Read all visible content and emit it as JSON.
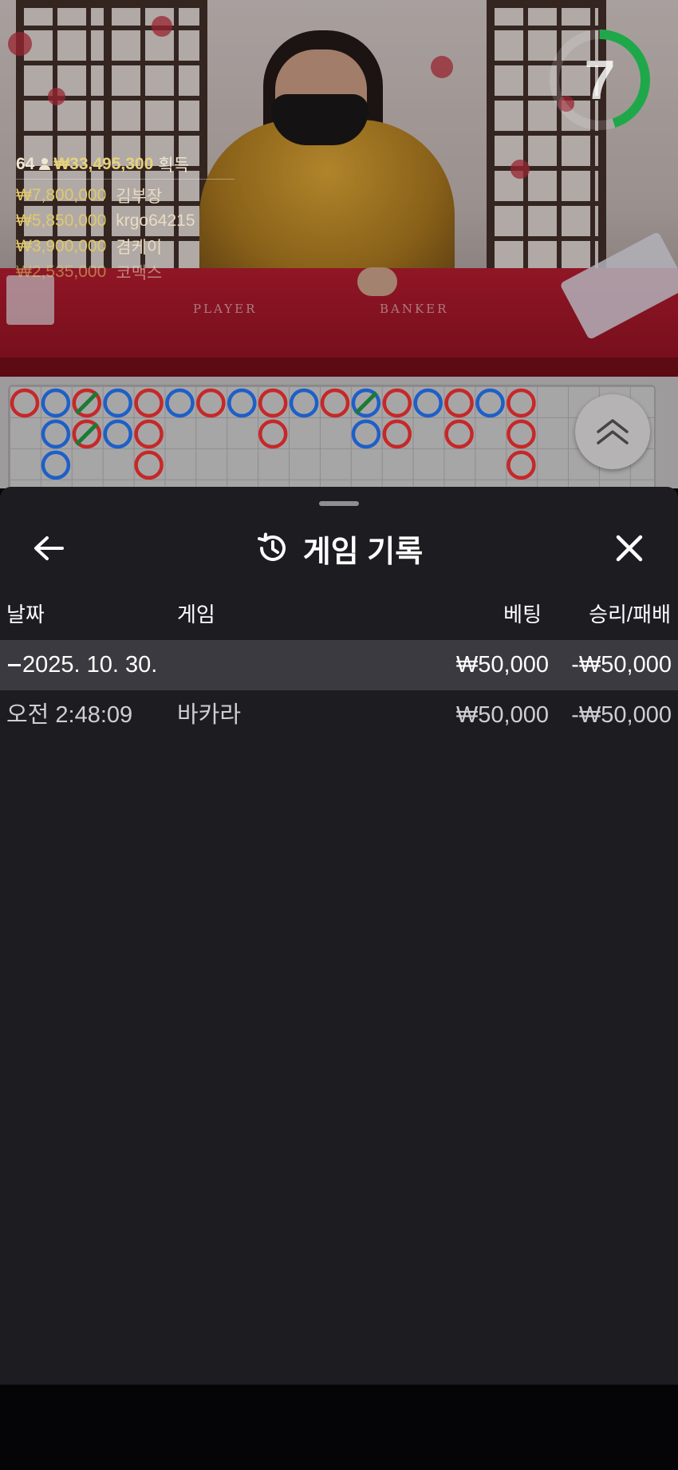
{
  "video": {
    "players_count": "64",
    "total_win": "₩33,495,300",
    "total_win_suffix": "획득",
    "felt_player": "PLAYER",
    "felt_banker": "BANKER",
    "timer": "7",
    "timer_fraction": 0.45,
    "winners": [
      {
        "amount": "₩7,800,000",
        "name": "김부장"
      },
      {
        "amount": "₩5,850,000",
        "name": "krgo64215"
      },
      {
        "amount": "₩3,900,000",
        "name": "겸케이"
      },
      {
        "amount": "₩2,535,000",
        "name": "코맥스"
      }
    ]
  },
  "roadmap": {
    "columns": [
      [
        "B"
      ],
      [
        "P",
        "P",
        "P"
      ],
      [
        "B/",
        "B/"
      ],
      [
        "P",
        "P"
      ],
      [
        "B",
        "B",
        "B"
      ],
      [
        "P"
      ],
      [
        "B"
      ],
      [
        "P"
      ],
      [
        "B",
        "B"
      ],
      [
        "P"
      ],
      [
        "B"
      ],
      [
        "P/",
        "P"
      ],
      [
        "B",
        "B"
      ],
      [
        "P"
      ],
      [
        "B",
        "B"
      ],
      [
        "P"
      ],
      [
        "B",
        "B",
        "B"
      ]
    ],
    "colors": {
      "banker": "#c62828",
      "player": "#1e5fc8",
      "tie": "#1b7a35"
    }
  },
  "sheet": {
    "title": "게임 기록",
    "columns": {
      "date": "날짜",
      "game": "게임",
      "bet": "베팅",
      "result": "승리/패배"
    },
    "groups": [
      {
        "date": "2025. 10. 30.",
        "bet": "₩50,000",
        "result": "-₩50,000",
        "rows": [
          {
            "time": "오전 2:48:09",
            "game": "바카라",
            "bet": "₩50,000",
            "result": "-₩50,000"
          }
        ]
      }
    ]
  },
  "icons": {
    "back": "arrow-left-icon",
    "history": "history-icon",
    "close": "close-icon",
    "expand": "chevron-double-up-icon",
    "collapse": "minus-icon"
  },
  "colors": {
    "sheet_bg": "#1d1c21",
    "row_highlight": "#3b3a40",
    "timer_green": "#1fa84a",
    "gold": "#e6d27a"
  }
}
